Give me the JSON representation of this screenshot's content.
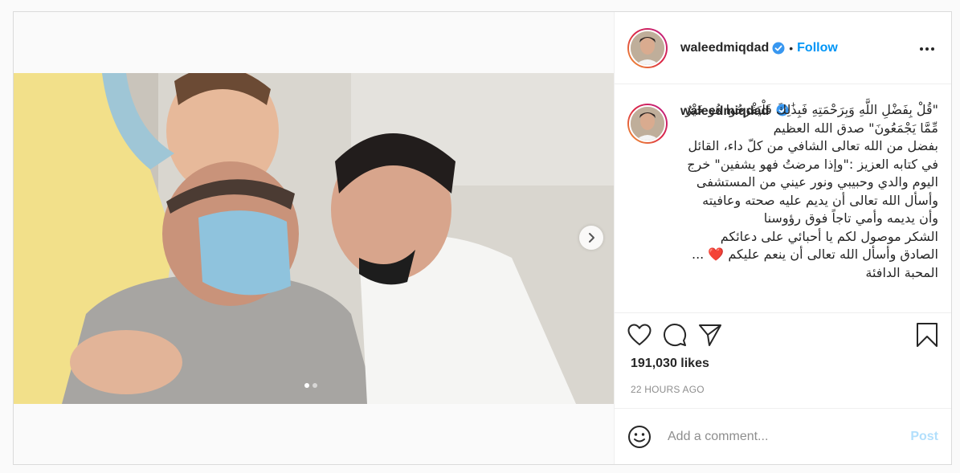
{
  "post": {
    "username": "waleedmiqdad",
    "follow_label": "Follow",
    "separator": "•",
    "caption": "\"قُلْ بِفَضْلِ اللَّهِ وَبِرَحْمَتِهِ فَبِذَٰلِكَ فَلْيَفْرَحُوا هُوَ خَيْرٌ مِّمَّا يَجْمَعُونَ\" صدق الله العظيم\nبفضل من الله تعالى الشافي من كلّ داء، القائل في كتابه العزيز :\"وإذا مرضتُ فهو يشفين\" خرج اليوم والدي وحبيبي ونور عيني من المستشفى وأسأل الله تعالى أن يديم عليه صحته وعافيته وأن يديمه وأمي تاجاً فوق رؤوسنا\nالشكر موصول لكم يا أحبائي على دعائكم الصادق وأسأل الله تعالى أن ينعم عليكم ❤️ ... المحبة الدافئة",
    "likes": "191,030 likes",
    "timestamp": "22 HOURS AGO",
    "carousel": {
      "current": 1,
      "total": 2
    }
  },
  "comment": {
    "placeholder": "Add a comment...",
    "post_label": "Post"
  },
  "icons": {
    "verified": "verified-badge-icon",
    "more": "more-options-icon",
    "like": "heart-icon",
    "comment": "comment-icon",
    "share": "share-icon",
    "save": "bookmark-icon",
    "emoji": "emoji-icon",
    "next": "chevron-right-icon"
  },
  "colors": {
    "accent": "#0095f6",
    "post_disabled": "#b2dffc",
    "muted": "#8e8e8e",
    "border": "#dbdbdb"
  }
}
